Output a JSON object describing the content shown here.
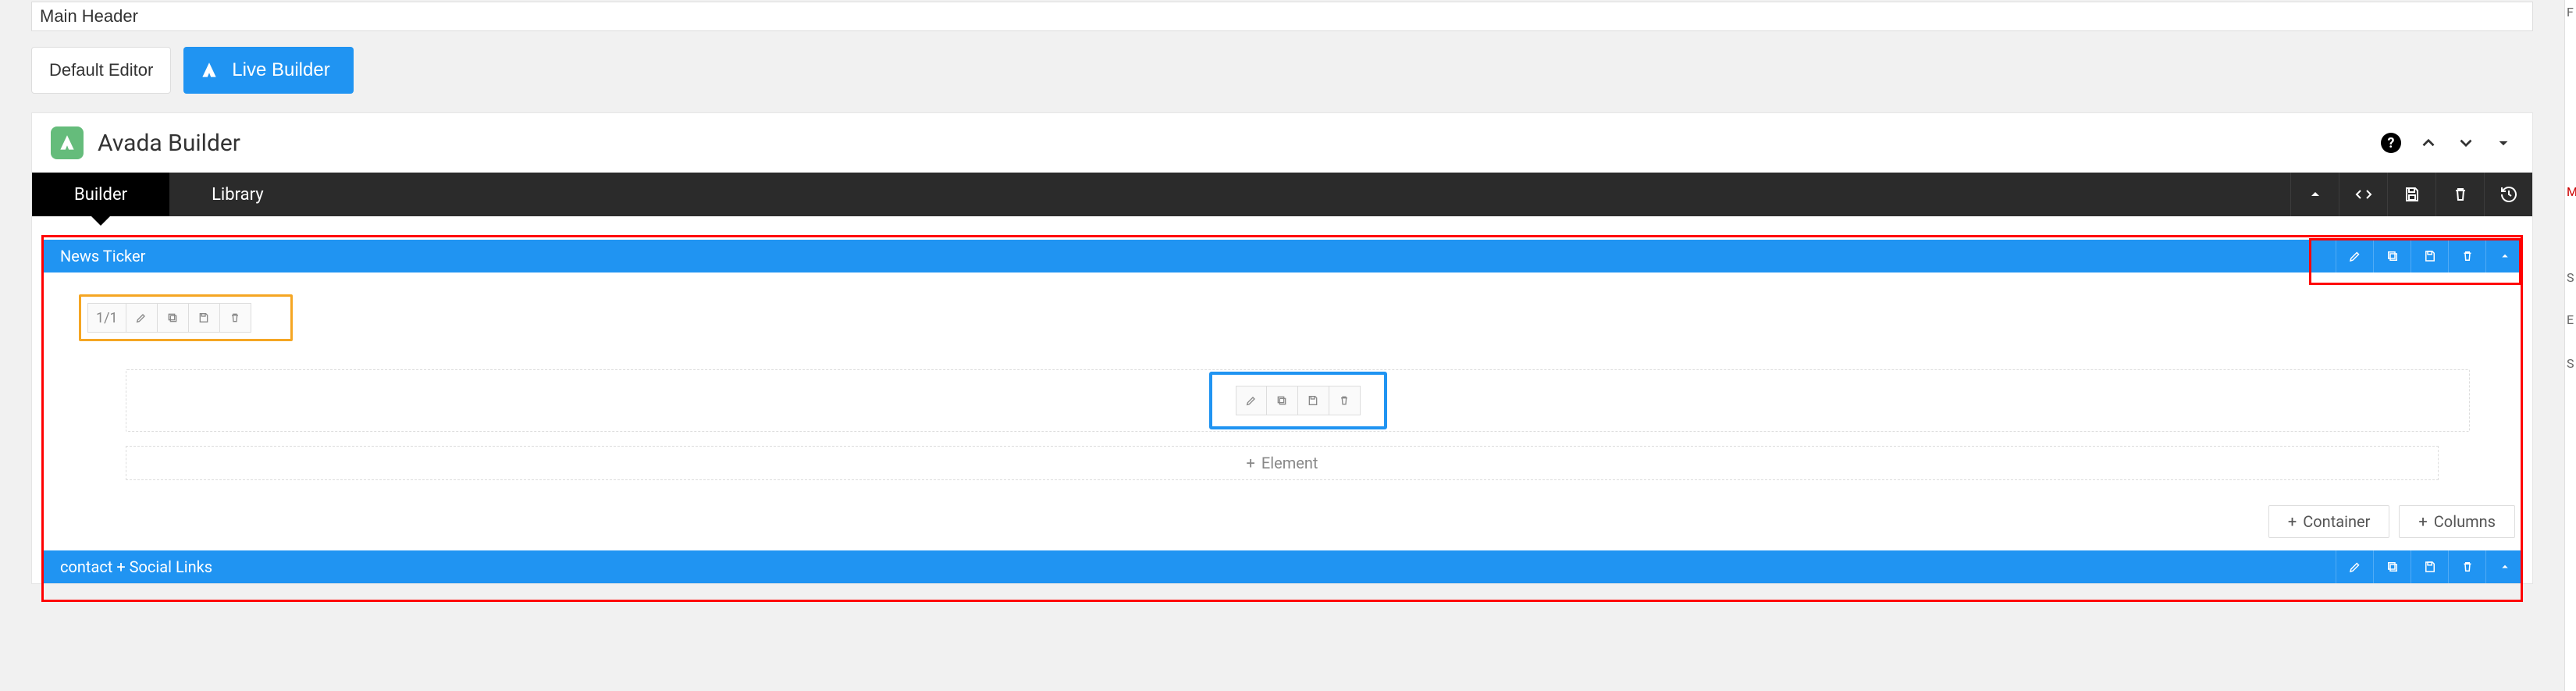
{
  "title_input": {
    "value": "Main Header"
  },
  "mode_buttons": {
    "default": "Default Editor",
    "live": "Live Builder"
  },
  "builder": {
    "title": "Avada Builder",
    "tabs": {
      "builder": "Builder",
      "library": "Library"
    }
  },
  "container1": {
    "label": "News Ticker",
    "column_fraction": "1/1",
    "add_element": "Element",
    "footer": {
      "add_container": "Container",
      "add_columns": "Columns"
    }
  },
  "container2": {
    "label": "contact + Social Links"
  },
  "right_stubs": {
    "a": "F",
    "b": "M",
    "c": "S",
    "d": "E",
    "e": "S"
  },
  "icons": {
    "help": "?",
    "plus": "+"
  }
}
